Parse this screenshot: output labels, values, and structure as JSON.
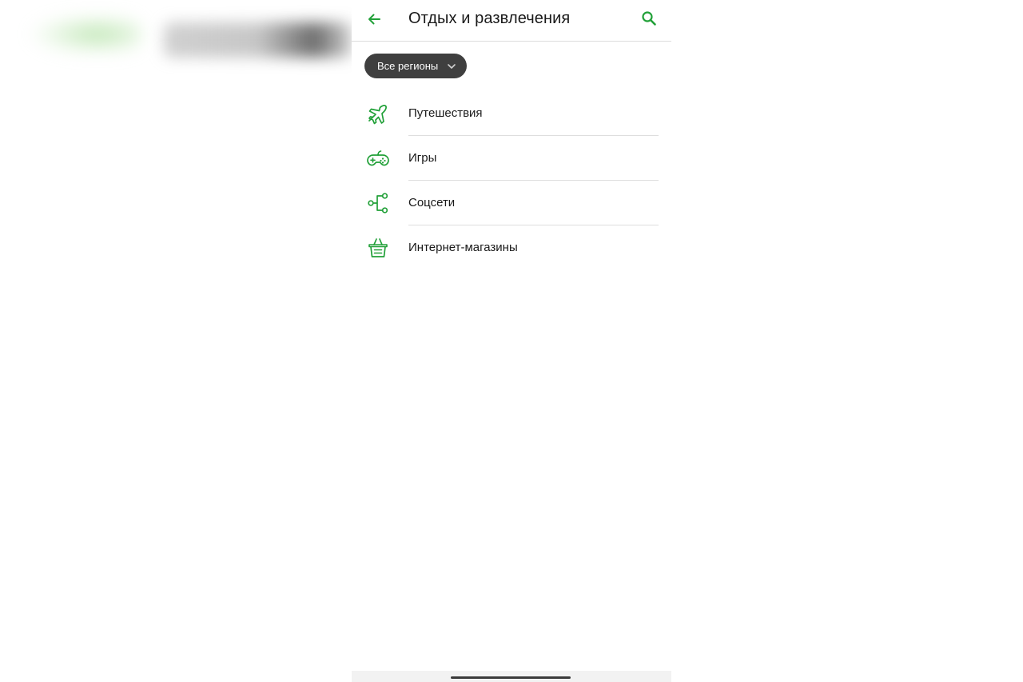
{
  "colors": {
    "accent": "#21a038",
    "chip_background": "#3f3f3f",
    "text": "#1a1a1a"
  },
  "header": {
    "back_icon": "arrow-left-icon",
    "title": "Отдых и развлечения",
    "search_icon": "search-icon"
  },
  "filter": {
    "region_label": "Все регионы",
    "chevron_icon": "chevron-down-icon"
  },
  "categories": [
    {
      "label": "Путешествия",
      "icon": "airplane-icon"
    },
    {
      "label": "Игры",
      "icon": "gamepad-icon"
    },
    {
      "label": "Соцсети",
      "icon": "share-nodes-icon"
    },
    {
      "label": "Интернет-магазины",
      "icon": "shopping-basket-icon"
    }
  ]
}
